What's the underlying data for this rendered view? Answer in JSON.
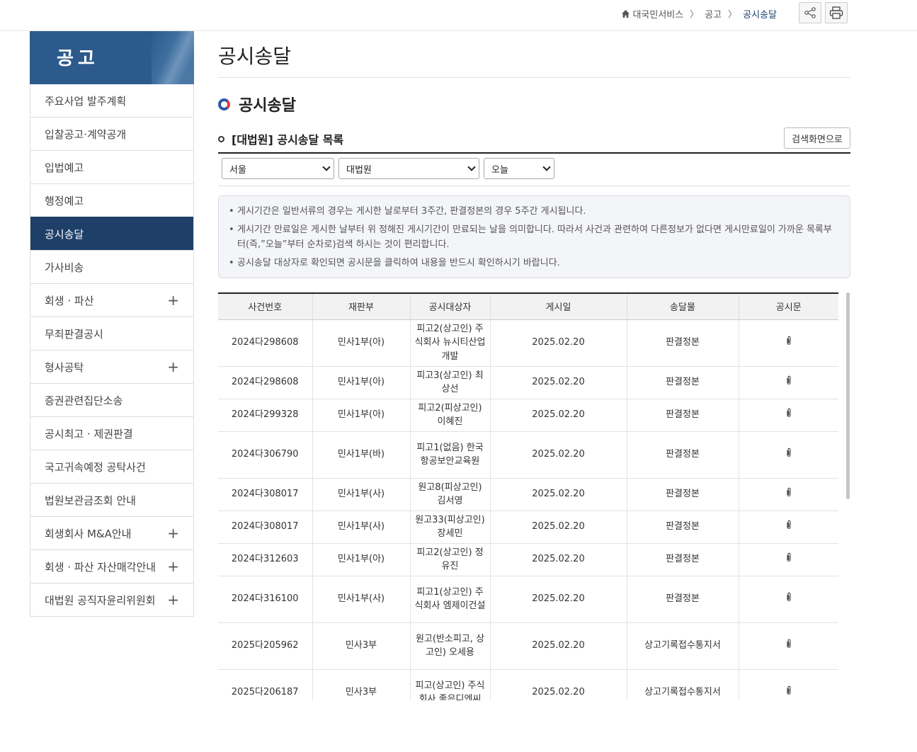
{
  "breadcrumb": {
    "home": "대국민서비스",
    "level1": "공고",
    "current": "공시송달"
  },
  "sidebar": {
    "title": "공고",
    "items": [
      {
        "label": "주요사업 발주계획",
        "expandable": false,
        "active": false
      },
      {
        "label": "입찰공고·계약공개",
        "expandable": false,
        "active": false
      },
      {
        "label": "입법예고",
        "expandable": false,
        "active": false
      },
      {
        "label": "행정예고",
        "expandable": false,
        "active": false
      },
      {
        "label": "공시송달",
        "expandable": false,
        "active": true
      },
      {
        "label": "가사비송",
        "expandable": false,
        "active": false
      },
      {
        "label": "회생 · 파산",
        "expandable": true,
        "active": false
      },
      {
        "label": "무죄판결공시",
        "expandable": false,
        "active": false
      },
      {
        "label": "형사공탁",
        "expandable": true,
        "active": false
      },
      {
        "label": "증권관련집단소송",
        "expandable": false,
        "active": false
      },
      {
        "label": "공시최고 · 제권판결",
        "expandable": false,
        "active": false
      },
      {
        "label": "국고귀속예정 공탁사건",
        "expandable": false,
        "active": false
      },
      {
        "label": "법원보관금조회 안내",
        "expandable": false,
        "active": false
      },
      {
        "label": "회생회사 M&A안내",
        "expandable": true,
        "active": false
      },
      {
        "label": "회생 · 파산 자산매각안내",
        "expandable": true,
        "active": false
      },
      {
        "label": "대법원 공직자윤리위원회",
        "expandable": true,
        "active": false
      }
    ]
  },
  "main": {
    "page_title": "공시송달",
    "section_title": "공시송달",
    "list_title": "[대법원] 공시송달 목록",
    "search_button": "검색화면으로",
    "filters": {
      "region": "서울",
      "court": "대법원",
      "period": "오늘"
    },
    "notices": [
      "게시기간은 일반서류의 경우는 게시한 날로부터 3주간, 판결정본의 경우 5주간 게시됩니다.",
      "게시기간 만료일은 게시한 날부터 위 정해진 게시기간이 만료되는 날을 의미합니다. 따라서 사건과 관련하여 다른정보가 없다면 게시만료일이 가까운 목록부터(즉,”오늘”부터 순차로)검색 하시는 것이 편리합니다.",
      "공시송달 대상자로 확인되면 공시문을 클릭하여 내용을 반드시 확인하시기 바랍니다."
    ],
    "table": {
      "headers": [
        "사건번호",
        "재판부",
        "공시대상자",
        "게시일",
        "송달물",
        "공시문"
      ],
      "rows": [
        {
          "case_no": "2024다298608",
          "division": "민사1부(아)",
          "target": "피고2(상고인) 주식회사 뉴시티산업개발",
          "date": "2025.02.20",
          "item": "판결정본"
        },
        {
          "case_no": "2024다298608",
          "division": "민사1부(아)",
          "target": "피고3(상고인) 최상선",
          "date": "2025.02.20",
          "item": "판결정본"
        },
        {
          "case_no": "2024다299328",
          "division": "민사1부(아)",
          "target": "피고2(피상고인) 이혜진",
          "date": "2025.02.20",
          "item": "판결정본"
        },
        {
          "case_no": "2024다306790",
          "division": "민사1부(바)",
          "target": "피고1(없음) 한국항공보안교육원",
          "date": "2025.02.20",
          "item": "판결정본"
        },
        {
          "case_no": "2024다308017",
          "division": "민사1부(사)",
          "target": "원고8(피상고인) 김서영",
          "date": "2025.02.20",
          "item": "판결정본"
        },
        {
          "case_no": "2024다308017",
          "division": "민사1부(사)",
          "target": "원고33(피상고인) 장세민",
          "date": "2025.02.20",
          "item": "판결정본"
        },
        {
          "case_no": "2024다312603",
          "division": "민사1부(아)",
          "target": "피고2(상고인) 정유진",
          "date": "2025.02.20",
          "item": "판결정본"
        },
        {
          "case_no": "2024다316100",
          "division": "민사1부(사)",
          "target": "피고1(상고인) 주식회사 엠제이건설",
          "date": "2025.02.20",
          "item": "판결정본"
        },
        {
          "case_no": "2025다205962",
          "division": "민사3부",
          "target": "원고(반소피고, 상고인) 오세용",
          "date": "2025.02.20",
          "item": "상고기록접수통지서"
        },
        {
          "case_no": "2025다206187",
          "division": "민사3부",
          "target": "피고(상고인) 주식회사 좋은디엔씨",
          "date": "2025.02.20",
          "item": "상고기록접수통지서"
        }
      ]
    }
  },
  "colors": {
    "active_nav": "#1d3f68",
    "header_blue": "#2d5a8c"
  }
}
